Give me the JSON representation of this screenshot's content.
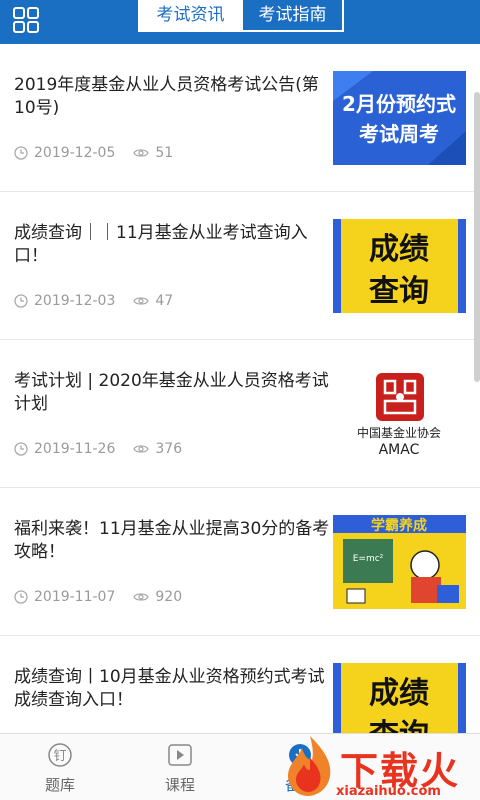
{
  "header": {
    "tabs": [
      {
        "label": "考试资讯",
        "active": true
      },
      {
        "label": "考试指南",
        "active": false
      }
    ]
  },
  "articles": [
    {
      "title": "2019年度基金从业人员资格考试公告(第10号)",
      "date": "2019-12-05",
      "views": "51",
      "thumb": {
        "line1": "2月份预约式",
        "line2": "考试周考"
      }
    },
    {
      "title": "成绩查询｜｜11月基金从业考试查询入口！",
      "date": "2019-12-03",
      "views": "47",
      "thumb": {
        "line1": "成绩",
        "line2": "查询"
      }
    },
    {
      "title": "考试计划 | 2020年基金从业人员资格考试计划",
      "date": "2019-11-26",
      "views": "376",
      "thumb": {
        "line1": "中国基金业协会",
        "line2": "AMAC"
      }
    },
    {
      "title": "福利来袭！11月基金从业提高30分的备考攻略！",
      "date": "2019-11-07",
      "views": "920",
      "thumb": {
        "line1": "学霸养成",
        "line2": "E=mc²"
      }
    },
    {
      "title": "成绩查询丨10月基金从业资格预约式考试成绩查询入口！",
      "date": "",
      "views": "",
      "thumb": {
        "line1": "成绩",
        "line2": "查询"
      }
    }
  ],
  "bottom_nav": [
    {
      "label": "题库",
      "icon": "nail-icon"
    },
    {
      "label": "课程",
      "icon": "play-icon"
    },
    {
      "label": "备考",
      "icon": "download-icon",
      "active": true
    }
  ],
  "watermark": {
    "text": "下载火",
    "url": "xiazaihuo.com"
  },
  "colors": {
    "primary": "#1b6fc2",
    "accent_yellow": "#f5d31c",
    "watermark_red": "#e8331f"
  }
}
